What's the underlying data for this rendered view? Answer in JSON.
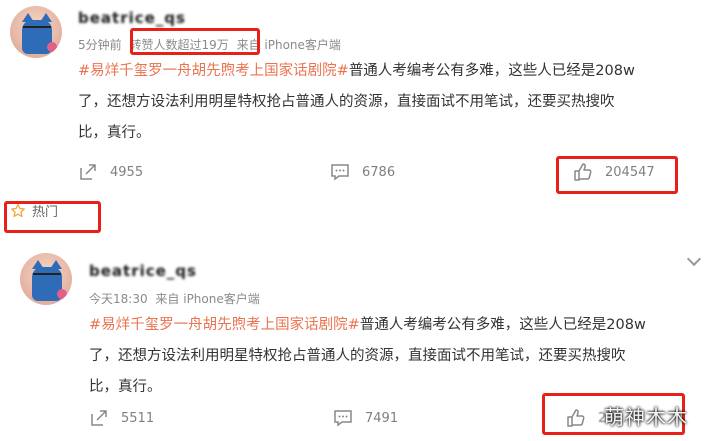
{
  "posts": [
    {
      "username": "beatrice_qs",
      "time": "5分钟前",
      "stat_note": "转赞人数超过19万",
      "source": "来自 iPhone客户端",
      "hashtag": "#易烊千玺罗一舟胡先煦考上国家话剧院#",
      "body_line1": "普通人考编考公有多难，这些人已经是208w",
      "body_line2": "了，还想方设法利用明星特权抢占普通人的资源，直接面试不用笔试，还要买热搜吹",
      "body_line3": "比，真行。",
      "share_count": "4955",
      "comment_count": "6786",
      "like_count": "204547"
    },
    {
      "username": "beatrice_qs",
      "time": "今天18:30",
      "source": "来自 iPhone客户端",
      "hashtag": "#易烊千玺罗一舟胡先煦考上国家话剧院#",
      "body_line1": "普通人考编考公有多难，这些人已经是208w",
      "body_line2": "了，还想方设法利用明星特权抢占普通人的资源，直接面试不用笔试，还要买热搜吹",
      "body_line3": "比，真行。",
      "share_count": "5511",
      "comment_count": "7491",
      "like_count": "22..."
    }
  ],
  "hot_label": "热门",
  "watermark": "萌神木木",
  "icons": {
    "share": "share-icon",
    "comment": "comment-icon",
    "like": "thumbs-up-icon",
    "hot": "star-icon",
    "more": "chevron-down-icon"
  },
  "colors": {
    "hashtag": "#eb7350",
    "highlight_box": "#e8201a",
    "meta_text": "#8a8a8a"
  }
}
